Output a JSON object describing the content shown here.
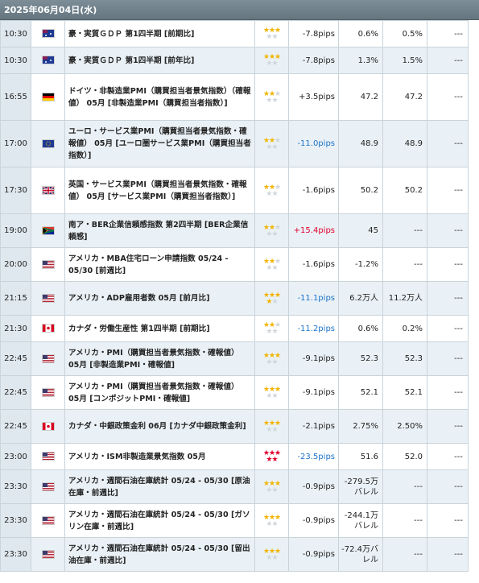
{
  "header": {
    "date": "2025年06月04日(水)"
  },
  "colors": {
    "header_bg": "#7d8e99",
    "row_alt": "#eaf1f6",
    "positive": "#e0002c",
    "negative": "#1b74c9",
    "star": "#f0b400"
  },
  "rows": [
    {
      "time": "10:30",
      "country": "australia-flag-icon",
      "event": "豪・実質ＧＤＰ 第1四半期 [前期比]",
      "stars": "3",
      "star_color": "gold",
      "pips": "-7.8pips",
      "pips_sign": "neutral",
      "previous": "0.6%",
      "forecast": "0.5%",
      "result": "---"
    },
    {
      "time": "10:30",
      "country": "australia-flag-icon",
      "event": "豪・実質ＧＤＰ 第1四半期 [前年比]",
      "stars": "3",
      "star_color": "gold",
      "pips": "-7.8pips",
      "pips_sign": "neutral",
      "previous": "1.3%",
      "forecast": "1.5%",
      "result": "---"
    },
    {
      "time": "16:55",
      "country": "germany-flag-icon",
      "event": "ドイツ・非製造業PMI（購買担当者景気指数）（確報値） 05月 [非製造業PMI（購買担当者指数）]",
      "stars": "2",
      "star_color": "gold",
      "pips": "+3.5pips",
      "pips_sign": "neutral",
      "previous": "47.2",
      "forecast": "47.2",
      "result": "---"
    },
    {
      "time": "17:00",
      "country": "eu-flag-icon",
      "event": "ユーロ・サービス業PMI（購買担当者景気指数・確報値） 05月 [ユーロ圏サービス業PMI（購買担当者指数）]",
      "stars": "2",
      "star_color": "gold",
      "pips": "-11.0pips",
      "pips_sign": "negative",
      "previous": "48.9",
      "forecast": "48.9",
      "result": "---"
    },
    {
      "time": "17:30",
      "country": "uk-flag-icon",
      "event": "英国・サービス業PMI（購買担当者景気指数・確報値） 05月 [サービス業PMI（購買担当者指数）]",
      "stars": "2",
      "star_color": "gold",
      "pips": "-1.6pips",
      "pips_sign": "neutral",
      "previous": "50.2",
      "forecast": "50.2",
      "result": "---"
    },
    {
      "time": "19:00",
      "country": "south-africa-flag-icon",
      "event": "南ア・BER企業信頼感指数 第2四半期 [BER企業信頼感]",
      "stars": "2",
      "star_color": "gold",
      "pips": "+15.4pips",
      "pips_sign": "positive",
      "previous": "45",
      "forecast": "---",
      "result": "---"
    },
    {
      "time": "20:00",
      "country": "usa-flag-icon",
      "event": "アメリカ・MBA住宅ローン申請指数 05/24 - 05/30 [前週比]",
      "stars": "2",
      "star_color": "gold",
      "pips": "-1.6pips",
      "pips_sign": "neutral",
      "previous": "-1.2%",
      "forecast": "---",
      "result": "---"
    },
    {
      "time": "21:15",
      "country": "usa-flag-icon",
      "event": "アメリカ・ADP雇用者数 05月 [前月比]",
      "stars": "4",
      "star_color": "gold",
      "pips": "-11.1pips",
      "pips_sign": "negative",
      "previous": "6.2万人",
      "forecast": "11.2万人",
      "result": "---"
    },
    {
      "time": "21:30",
      "country": "canada-flag-icon",
      "event": "カナダ・労働生産性 第1四半期 [前期比]",
      "stars": "2",
      "star_color": "gold",
      "pips": "-11.2pips",
      "pips_sign": "negative",
      "previous": "0.6%",
      "forecast": "0.2%",
      "result": "---"
    },
    {
      "time": "22:45",
      "country": "usa-flag-icon",
      "event": "アメリカ・PMI（購買担当者景気指数・確報値） 05月 [非製造業PMI・確報値]",
      "stars": "3",
      "star_color": "gold",
      "pips": "-9.1pips",
      "pips_sign": "neutral",
      "previous": "52.3",
      "forecast": "52.3",
      "result": "---"
    },
    {
      "time": "22:45",
      "country": "usa-flag-icon",
      "event": "アメリカ・PMI（購買担当者景気指数・確報値） 05月 [コンポジットPMI・確報値]",
      "stars": "3",
      "star_color": "gold",
      "pips": "-9.1pips",
      "pips_sign": "neutral",
      "previous": "52.1",
      "forecast": "52.1",
      "result": "---"
    },
    {
      "time": "22:45",
      "country": "canada-flag-icon",
      "event": "カナダ・中銀政策金利 06月 [カナダ中銀政策金利]",
      "stars": "3",
      "star_color": "gold",
      "pips": "-2.1pips",
      "pips_sign": "neutral",
      "previous": "2.75%",
      "forecast": "2.50%",
      "result": "---"
    },
    {
      "time": "23:00",
      "country": "usa-flag-icon",
      "event": "アメリカ・ISM非製造業景気指数 05月",
      "stars": "5",
      "star_color": "red",
      "pips": "-23.5pips",
      "pips_sign": "negative",
      "previous": "51.6",
      "forecast": "52.0",
      "result": "---"
    },
    {
      "time": "23:30",
      "country": "usa-flag-icon",
      "event": "アメリカ・週間石油在庫統計 05/24 - 05/30 [原油在庫・前週比]",
      "stars": "3",
      "star_color": "gold",
      "pips": "-0.9pips",
      "pips_sign": "neutral",
      "previous": "-279.5万バレル",
      "forecast": "---",
      "result": "---"
    },
    {
      "time": "23:30",
      "country": "usa-flag-icon",
      "event": "アメリカ・週間石油在庫統計 05/24 - 05/30 [ガソリン在庫・前週比]",
      "stars": "3",
      "star_color": "gold",
      "pips": "-0.9pips",
      "pips_sign": "neutral",
      "previous": "-244.1万バレル",
      "forecast": "---",
      "result": "---"
    },
    {
      "time": "23:30",
      "country": "usa-flag-icon",
      "event": "アメリカ・週間石油在庫統計 05/24 - 05/30 [留出油在庫・前週比]",
      "stars": "3",
      "star_color": "gold",
      "pips": "-0.9pips",
      "pips_sign": "neutral",
      "previous": "-72.4万バレル",
      "forecast": "---",
      "result": "---"
    }
  ]
}
